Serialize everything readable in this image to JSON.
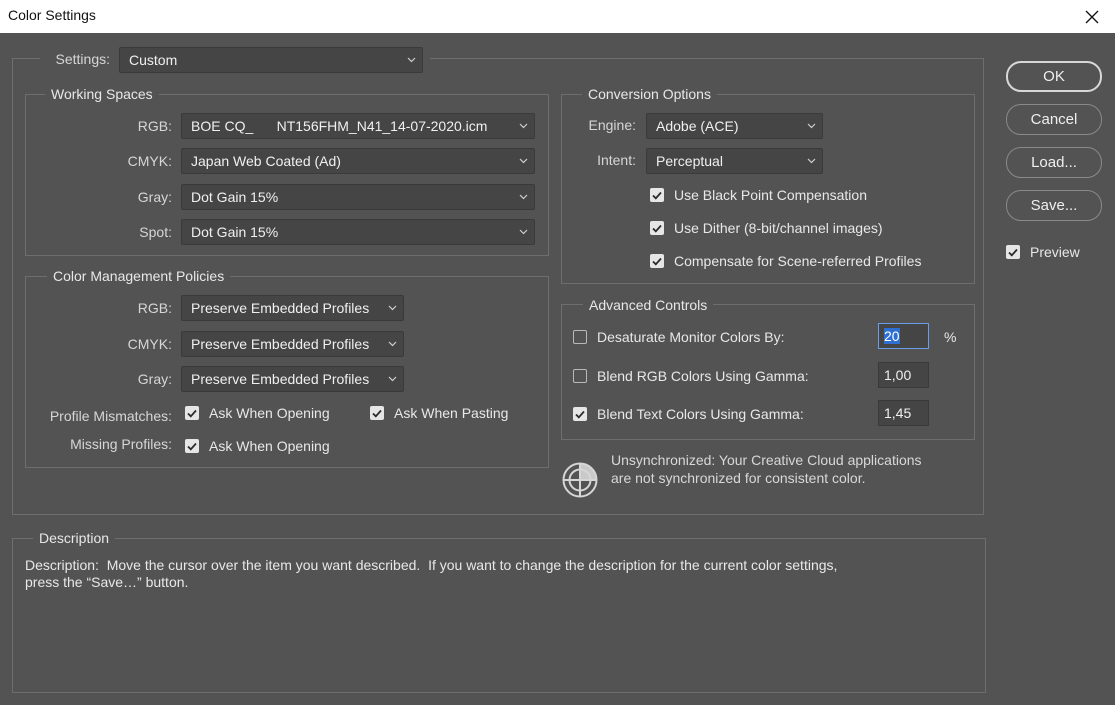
{
  "window": {
    "title": "Color Settings",
    "close_glyph": "✕"
  },
  "settings": {
    "label": "Settings:",
    "value": "Custom"
  },
  "working_spaces": {
    "title": "Working Spaces",
    "rgb": {
      "label": "RGB:",
      "value": "BOE CQ_      NT156FHM_N41_14-07-2020.icm"
    },
    "cmyk": {
      "label": "CMYK:",
      "value": "Japan Web Coated (Ad)"
    },
    "gray": {
      "label": "Gray:",
      "value": "Dot Gain 15%"
    },
    "spot": {
      "label": "Spot:",
      "value": "Dot Gain 15%"
    }
  },
  "policies": {
    "title": "Color Management Policies",
    "rgb": {
      "label": "RGB:",
      "value": "Preserve Embedded Profiles"
    },
    "cmyk": {
      "label": "CMYK:",
      "value": "Preserve Embedded Profiles"
    },
    "gray": {
      "label": "Gray:",
      "value": "Preserve Embedded Profiles"
    },
    "profile_mismatches": {
      "label": "Profile Mismatches:",
      "ask_opening": {
        "label": "Ask When Opening",
        "checked": true
      },
      "ask_pasting": {
        "label": "Ask When Pasting",
        "checked": true
      }
    },
    "missing_profiles": {
      "label": "Missing Profiles:",
      "ask_opening": {
        "label": "Ask When Opening",
        "checked": true
      }
    }
  },
  "conversion": {
    "title": "Conversion Options",
    "engine": {
      "label": "Engine:",
      "value": "Adobe (ACE)"
    },
    "intent": {
      "label": "Intent:",
      "value": "Perceptual"
    },
    "black_point": {
      "label": "Use Black Point Compensation",
      "checked": true
    },
    "dither": {
      "label": "Use Dither (8-bit/channel images)",
      "checked": true
    },
    "scene_referred": {
      "label": "Compensate for Scene-referred Profiles",
      "checked": true
    }
  },
  "advanced": {
    "title": "Advanced Controls",
    "desaturate": {
      "label": "Desaturate Monitor Colors By:",
      "checked": false,
      "value": "20",
      "unit": "%"
    },
    "blend_rgb": {
      "label": "Blend RGB Colors Using Gamma:",
      "checked": false,
      "value": "1,00"
    },
    "blend_text": {
      "label": "Blend Text Colors Using Gamma:",
      "checked": true,
      "value": "1,45"
    }
  },
  "sync": {
    "line1": "Unsynchronized: Your Creative Cloud applications",
    "line2": "are not synchronized for consistent color."
  },
  "description": {
    "title": "Description",
    "line1": "Description:  Move the cursor over the item you want described.  If you want to change the description for the current color settings,",
    "line2": "press the “Save…” button."
  },
  "buttons": {
    "ok": "OK",
    "cancel": "Cancel",
    "load": "Load...",
    "save": "Save..."
  },
  "preview": {
    "label": "Preview",
    "checked": true
  },
  "colors": {
    "background": "#535353",
    "field": "#454545",
    "focus": "#2f6fd1"
  }
}
